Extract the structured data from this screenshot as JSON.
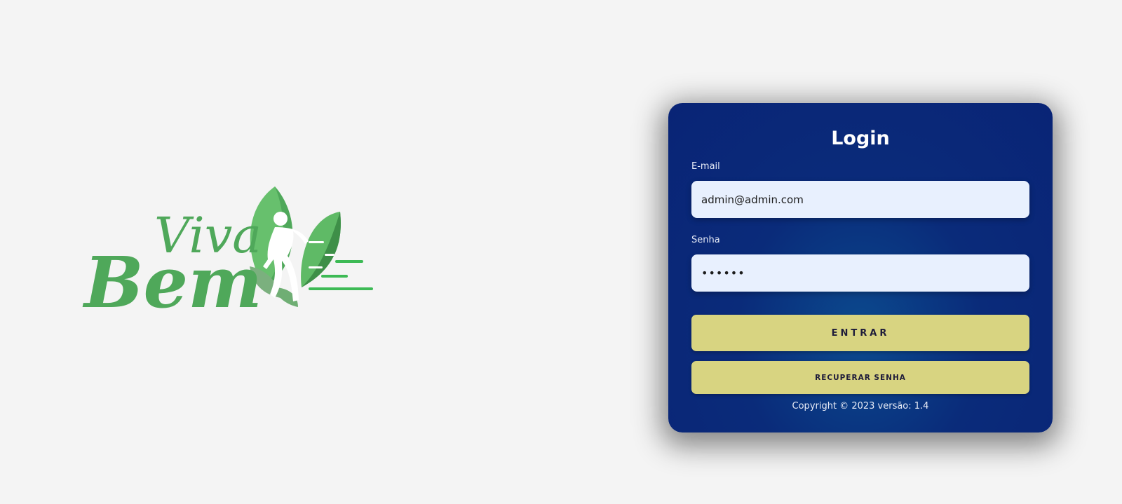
{
  "logo": {
    "text_top": "Viva",
    "text_bottom": "Bem",
    "color_primary": "#4fa85a",
    "color_light": "#67c06d",
    "color_dark": "#3e8f48",
    "color_lines": "#3dba55"
  },
  "login": {
    "title": "Login",
    "email_label": "E-mail",
    "email_value": "admin@admin.com",
    "password_label": "Senha",
    "password_value": "••••••",
    "submit_label": "ENTRAR",
    "recover_label": "RECUPERAR SENHA",
    "copyright": "Copyright © 2023 versão: 1.4"
  },
  "colors": {
    "background": "#f4f4f4",
    "card": "#0a2b7a",
    "button": "#d8d481",
    "input": "#e8f0fe"
  }
}
